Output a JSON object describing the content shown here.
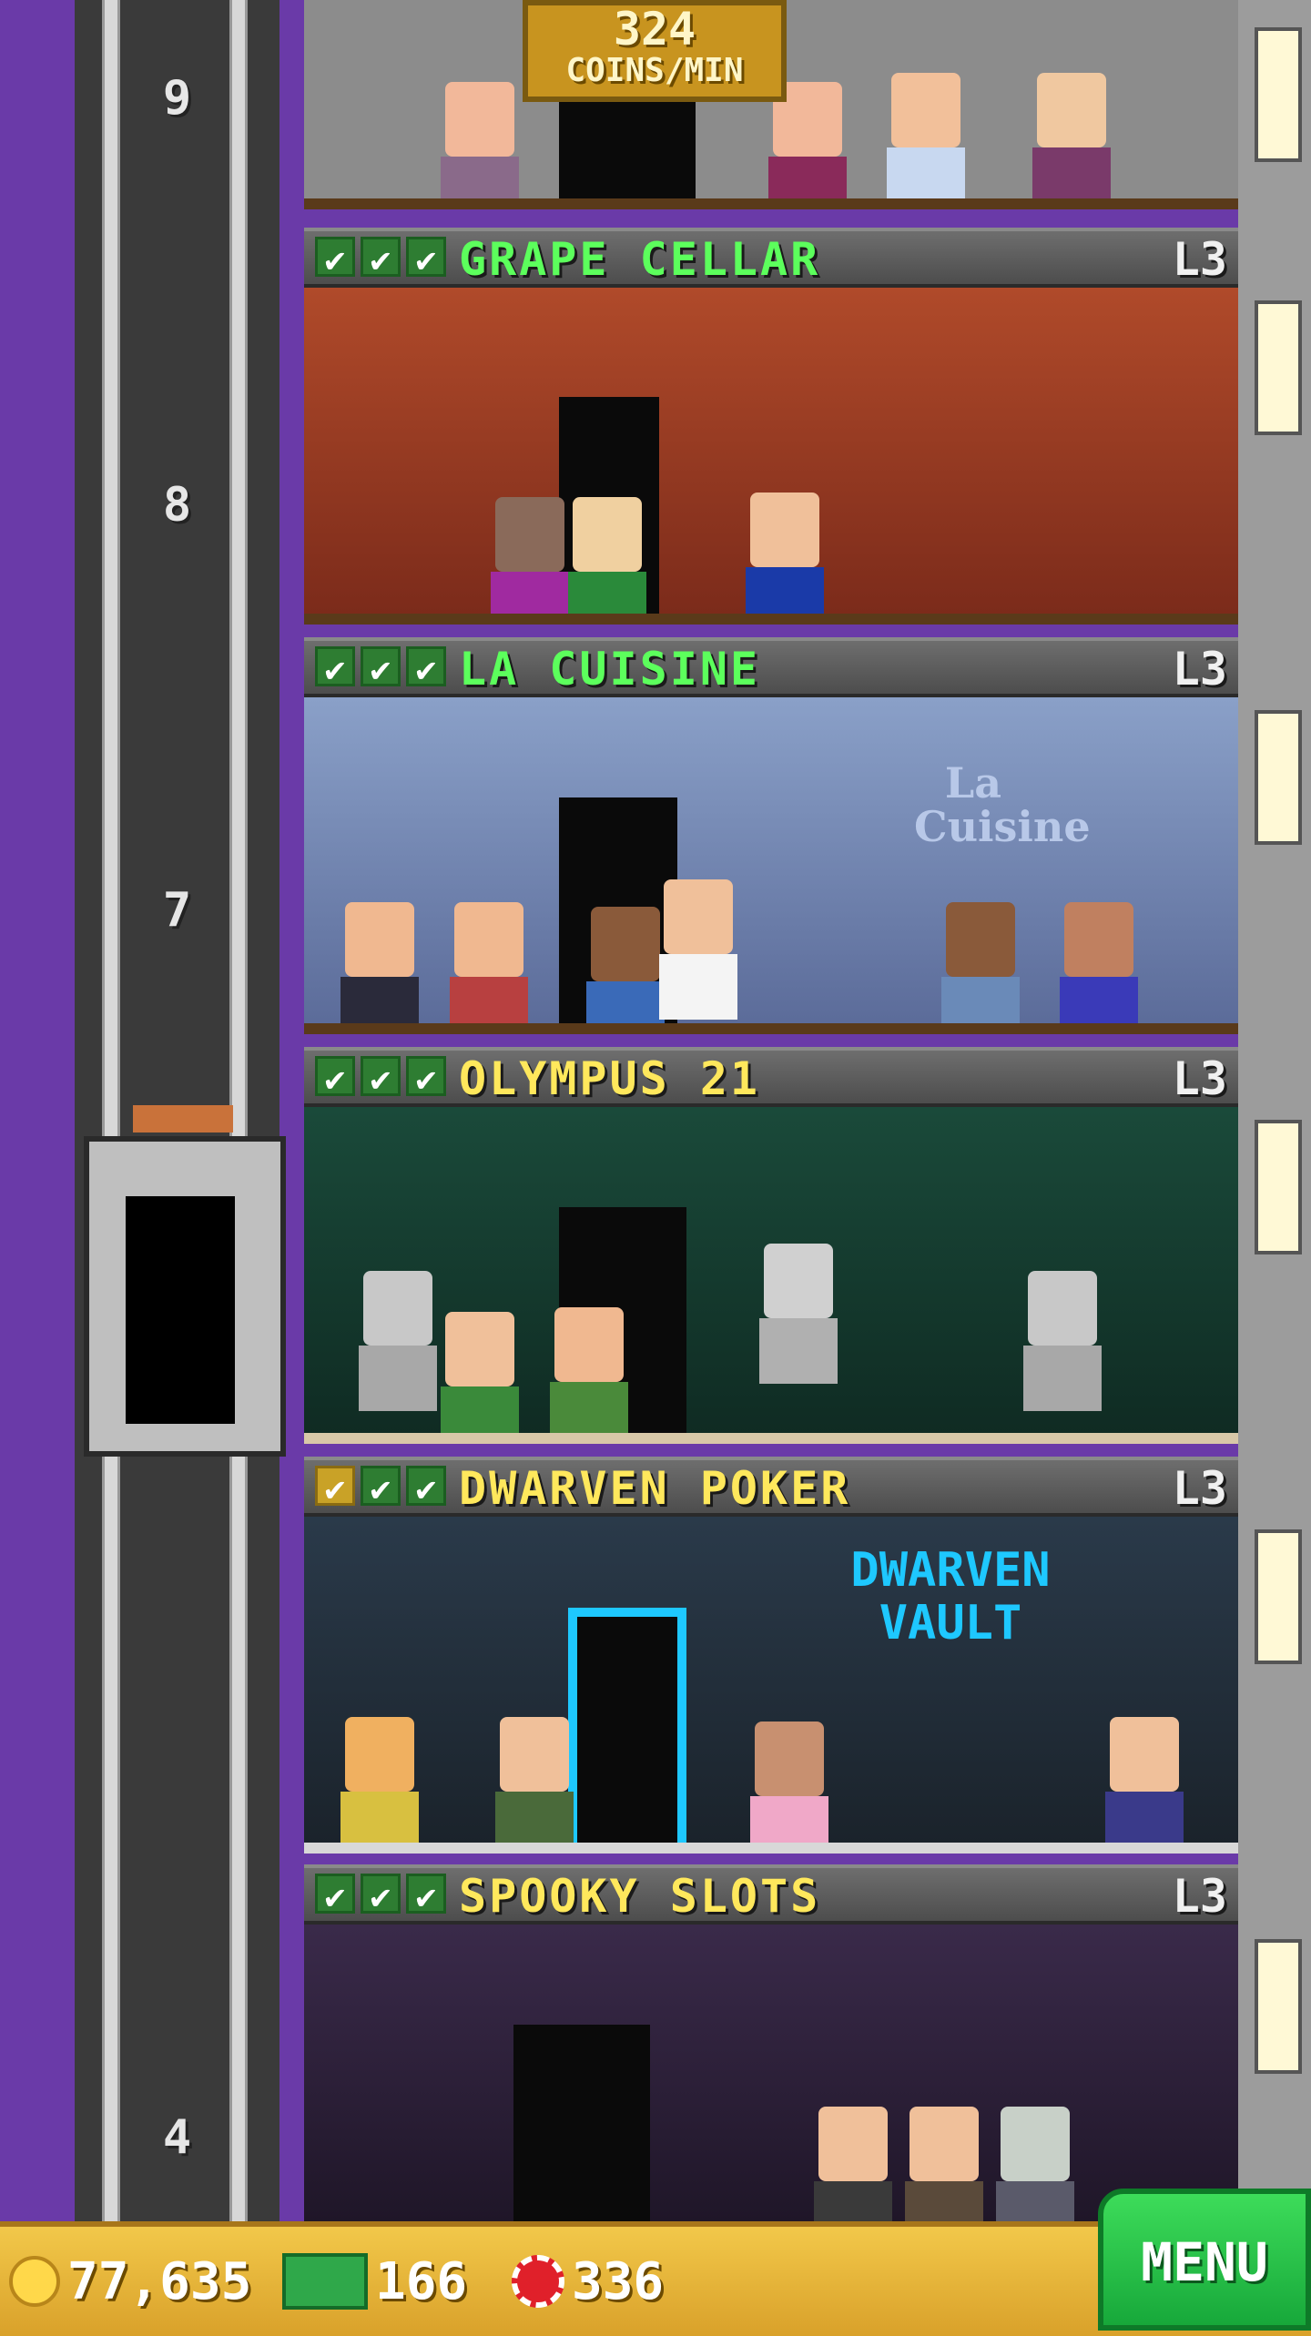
{
  "coin_banner": {
    "amount": "324",
    "unit": "COINS/MIN"
  },
  "elevator": {
    "floor_numbers": [
      "9",
      "8",
      "7",
      "4"
    ]
  },
  "floors": [
    {
      "name": "GRAPE CELLAR",
      "level": "L3",
      "name_color": "#5cff5c",
      "checks": 3
    },
    {
      "name": "LA CUISINE",
      "level": "L3",
      "name_color": "#5cff5c",
      "checks": 3
    },
    {
      "name": "OLYMPUS 21",
      "level": "L3",
      "name_color": "#ffe85c",
      "checks": 3
    },
    {
      "name": "DWARVEN POKER",
      "level": "L3",
      "name_color": "#ffe85c",
      "checks": 3
    },
    {
      "name": "SPOOKY SLOTS",
      "level": "L3",
      "name_color": "#ffe85c",
      "checks": 3
    }
  ],
  "signs": {
    "cuisine_sign": "La Cuisine",
    "dwarven_sign": "DWARVEN VAULT"
  },
  "hud": {
    "coins": "77,635",
    "bux": "166",
    "chips": "336",
    "menu_label": "MENU"
  },
  "colors": {
    "sky": "#6a3aa8",
    "hud_gold": "#f2c84a",
    "menu_green": "#17a83a",
    "check_green": "#2e7d32"
  }
}
